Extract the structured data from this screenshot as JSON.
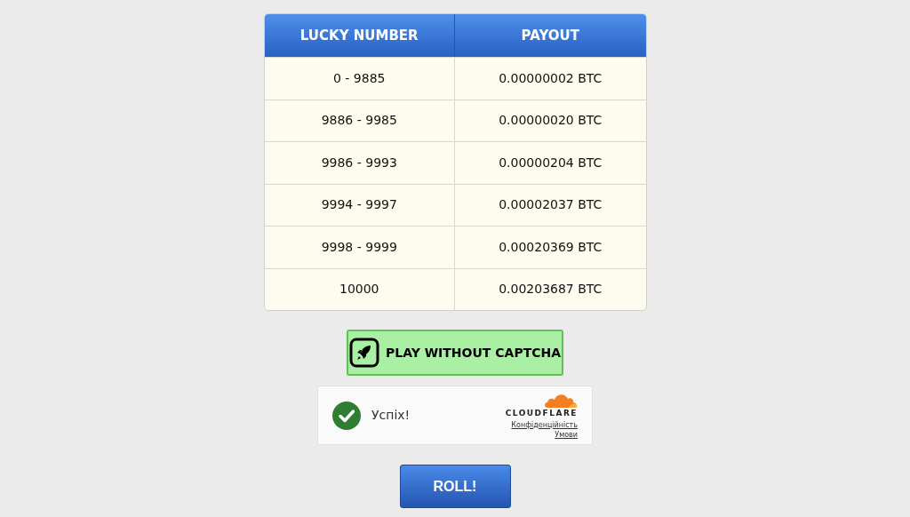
{
  "table": {
    "columns": [
      "LUCKY NUMBER",
      "PAYOUT"
    ],
    "rows": [
      [
        "0 - 9885",
        "0.00000002 BTC"
      ],
      [
        "9886 - 9985",
        "0.00000020 BTC"
      ],
      [
        "9986 - 9993",
        "0.00000204 BTC"
      ],
      [
        "9994 - 9997",
        "0.00002037 BTC"
      ],
      [
        "9998 - 9999",
        "0.00020369 BTC"
      ],
      [
        "10000",
        "0.00203687 BTC"
      ]
    ]
  },
  "play_button": {
    "label": "PLAY WITHOUT CAPTCHA"
  },
  "captcha": {
    "status": "Успіх!",
    "verified": true,
    "brand": "CLOUDFLARE",
    "links": [
      "Конфіденційність",
      "Умови"
    ]
  },
  "roll_button": {
    "label": "ROLL!"
  }
}
